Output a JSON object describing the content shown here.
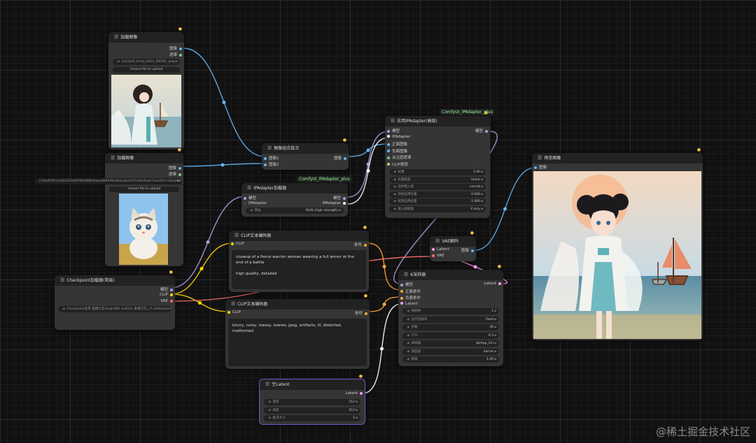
{
  "colors": {
    "image": "#64b5f6",
    "model": "#b39ddb",
    "clip": "#ffd500",
    "vae": "#ff6e6e",
    "conditioning": "#ffa931",
    "latent": "#ff9cf9",
    "ipadapter": "#ffffff",
    "mask": "#81c784"
  },
  "nodes": {
    "load1": {
      "title": "加载图像",
      "out_image": "图像",
      "out_mask": "遮罩",
      "file": "ComfyUI_temp_tlztm_00036_.png",
      "upload": "choose file to upload"
    },
    "load2": {
      "title": "加载图像",
      "out_image": "图像",
      "out_mask": "遮罩",
      "file": "c1efa87651c4d22202d978a0986d5aeed99599a68d2ab2d5f7c83dfcb473e2d5f7c3f2a0fbf726b2bf0b17f2e99e84b7e1",
      "upload": "choose file to upload"
    },
    "batch": {
      "title": "图像组合批次",
      "in1": "图像1",
      "in2": "图像2",
      "out": "图像"
    },
    "ipaLoader": {
      "pack": "ComfyUI_IPAdapter_plus",
      "title": "IPAdapter加载器",
      "in_model": "模型",
      "in_ipa": "IPAdapter",
      "out_model": "模型",
      "out_ipa": "IPAdapter",
      "w_preset": "预设",
      "w_preset_val": "PLUS (high strength)"
    },
    "ipaApply": {
      "pack": "ComfyUI_IPAdapter_plus",
      "title": "应用IPAdapter(高级)",
      "inputs": [
        "模型",
        "IPAdapter",
        "正面图像",
        "负面图像",
        "关注层遮罩",
        "CLIP视觉"
      ],
      "out": "模型",
      "widgets": [
        [
          "权重",
          "1.00"
        ],
        [
          "权重类型",
          "linear"
        ],
        [
          "合并嵌入组",
          "concat"
        ],
        [
          "开始应用位置",
          "0.000"
        ],
        [
          "结束应用位置",
          "1.000"
        ],
        [
          "嵌入组缩放",
          "V only"
        ]
      ]
    },
    "ckpt": {
      "title": "Checkpoint加载器(简易)",
      "out_model": "模型",
      "out_clip": "CLIP",
      "out_vae": "VAE",
      "w_ckpt": "Checkpoint名称",
      "w_ckpt_val": "麦橘写实/majicMIX realistic 麦橘写实_v7.safetensors"
    },
    "clip1": {
      "title": "CLIP文本编码器",
      "in": "CLIP",
      "out": "条件",
      "text": "closeup of a fierce warrior woman wearing a full armor at the end of a battle\n\nhigh quality, detailed"
    },
    "clip2": {
      "title": "CLIP文本编码器",
      "in": "CLIP",
      "out": "条件",
      "text": "blurry, noisy, messy, lowres, jpeg, artifacts, ill, distorted, malformed"
    },
    "vae": {
      "title": "VAE解码",
      "in_latent": "Latent",
      "in_vae": "VAE",
      "out": "图像"
    },
    "ksampler": {
      "title": "K采样器",
      "inputs": [
        "模型",
        "正面条件",
        "负面条件",
        "Latent"
      ],
      "out": "Latent",
      "widgets": [
        [
          "随机种",
          "1"
        ],
        [
          "运行后操作",
          "fixed"
        ],
        [
          "步数",
          "30"
        ],
        [
          "CFG",
          "6.5"
        ],
        [
          "采样器",
          "dpmpp_2m"
        ],
        [
          "调度器",
          "karras"
        ],
        [
          "降噪",
          "1.00"
        ]
      ]
    },
    "empty": {
      "title": "空Latent",
      "out": "Latent",
      "widgets": [
        [
          "宽度",
          "512"
        ],
        [
          "高度",
          "512"
        ],
        [
          "批次大小",
          "1"
        ]
      ]
    },
    "preview": {
      "title": "预览图像",
      "in": "图像"
    }
  },
  "watermark": "@稀土掘金技术社区"
}
